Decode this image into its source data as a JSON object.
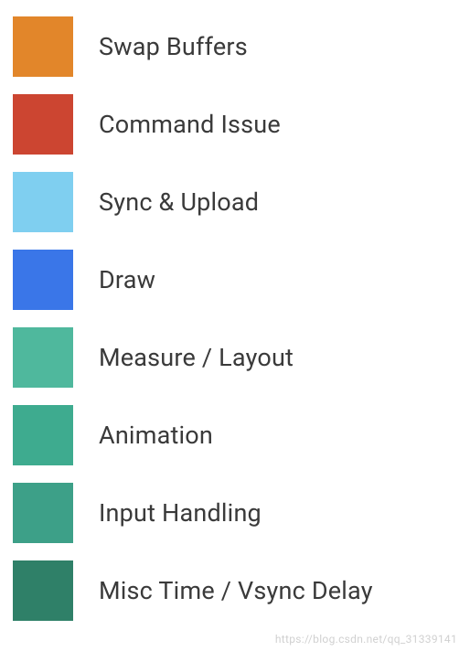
{
  "legend": {
    "items": [
      {
        "label": "Swap Buffers",
        "color": "#e2862a"
      },
      {
        "label": "Command Issue",
        "color": "#cc4531"
      },
      {
        "label": "Sync & Upload",
        "color": "#7fcff0"
      },
      {
        "label": "Draw",
        "color": "#3a76e8"
      },
      {
        "label": "Measure / Layout",
        "color": "#4fb89d"
      },
      {
        "label": "Animation",
        "color": "#3eab8f"
      },
      {
        "label": "Input Handling",
        "color": "#3da088"
      },
      {
        "label": "Misc Time / Vsync Delay",
        "color": "#2f8068"
      }
    ]
  },
  "watermark": "https://blog.csdn.net/qq_31339141"
}
